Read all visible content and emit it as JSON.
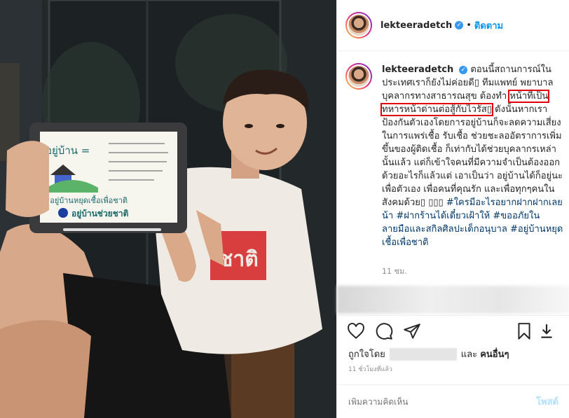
{
  "header": {
    "username": "lekteeradetch",
    "dot": "•",
    "follow_label": "ติดตาม"
  },
  "caption": {
    "username": "lekteeradetch",
    "text_1": "ตอนนี้สถานการณ์ในประเทศเราก็ยังไม่ค่อยดี▯ ทีมแพทย์ พยาบาล บุคลากรทางสาธารณสุข ต้องทำ",
    "text_highlight": "หน้าที่เป็นทหารหน้าด่านต่อสู้กับไวรัส▯",
    "text_2": "ดังนั้นหากเราป้องกันตัวเองโดยการอยู่บ้านก็จะลดความเสี่ยงในการแพร่เชื้อ รับเชื้อ ช่วยชะลออัตราการเพิ่มขึ้นของผู้ติดเชื้อ ก็เท่ากับได้ช่วยบุคลากรเหล่านั้นแล้ว แต่ก็เข้าใจคนที่มีความจำเป็นต้องออก ด้วยอะไรก็แล้วแต่ เอาเป็นว่า อยู่บ้านได้ก็อยู่นะ เพื่อตัวเอง เพื่อคนที่คุณรัก และเพื่อทุกๆคนในสังคมด้วย▯ ▯▯▯",
    "hashtags": [
      "#ใครมีอะไรอยากฝากฝากเลยน้า",
      "#ฝากร้านได้เดี๋ยวเฝ้าให้",
      "#ขออภัยในลายมือและสกิลศิลปะเด็กอนุบาล",
      "#อยู่บ้านหยุดเชื้อเพื่อชาติ"
    ],
    "time": "11 ชม."
  },
  "likes": {
    "liked_by": "ถูกใจโดย",
    "and": "และ",
    "others": "คนอื่นๆ"
  },
  "ago": "11 ชั่วโมงที่แล้ว",
  "comment": {
    "placeholder": "เพิ่มความคิดเห็น",
    "post_label": "โพสต์"
  },
  "photo": {
    "board_line1": "อยู่บ้าน  =",
    "board_line2": "#อยู่บ้านหยุดเชื้อเพื่อชาติ",
    "board_logo_text": "อยู่บ้านช่วยชาติ",
    "shirt_text": "ชาติ"
  },
  "icons": {
    "heart": "heart-icon",
    "comment": "comment-icon",
    "share": "share-icon",
    "save": "bookmark-icon",
    "download": "download-icon"
  },
  "colors": {
    "accent": "#0095f6",
    "highlight_box": "#e0000b",
    "hashtag": "#00376b",
    "verified": "#3897f0"
  }
}
